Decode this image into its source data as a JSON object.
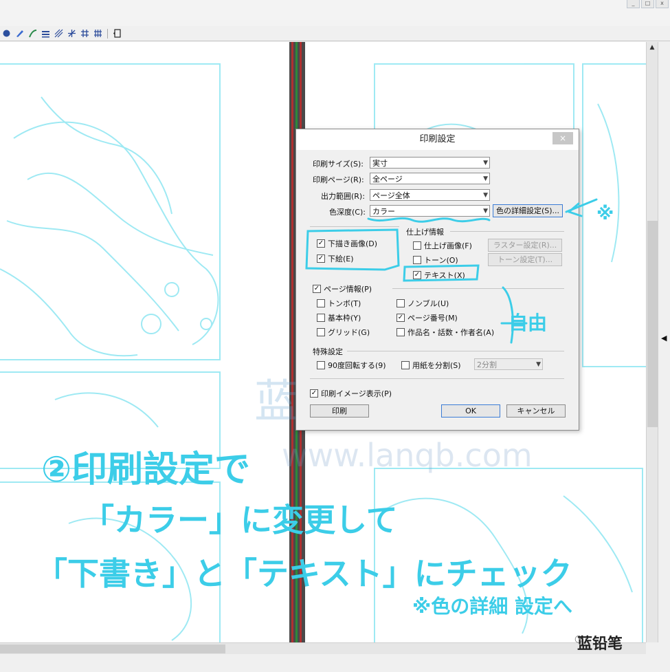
{
  "window": {
    "minimize": "_",
    "maximize": "□",
    "close": "x"
  },
  "toolbar": {
    "icons": [
      "paint-icon",
      "brush-icon",
      "pen-icon",
      "layer-icon",
      "hatch-icon",
      "ruler-icon",
      "grid-icon",
      "grid-alt-icon",
      "panel-icon"
    ]
  },
  "dialog": {
    "title": "印刷設定",
    "close": "×",
    "print_size": {
      "label": "印刷サイズ(S):",
      "value": "実寸"
    },
    "print_page": {
      "label": "印刷ページ(R):",
      "value": "全ページ"
    },
    "output_range": {
      "label": "出力範囲(R):",
      "value": "ページ全体"
    },
    "color_depth": {
      "label": "色深度(C):",
      "value": "カラー"
    },
    "color_detail_button": "色の詳細設定(S)...",
    "draft_group": {
      "rough_sketch": {
        "label": "下描き画像(D)",
        "checked": true
      },
      "draft": {
        "label": "下絵(E)",
        "checked": true
      }
    },
    "finish_group": {
      "title": "仕上げ情報",
      "finish_image": {
        "label": "仕上げ画像(F)",
        "checked": false
      },
      "tone": {
        "label": "トーン(O)",
        "checked": false
      },
      "text": {
        "label": "テキスト(X)",
        "checked": true
      },
      "raster_button": "ラスター設定(R)...",
      "tone_button": "トーン設定(T)..."
    },
    "page_info": {
      "label": "ページ情報(P)",
      "checked": true,
      "tombo": {
        "label": "トンボ(T)",
        "checked": false
      },
      "nombre": {
        "label": "ノンブル(U)",
        "checked": false
      },
      "base_frame": {
        "label": "基本枠(Y)",
        "checked": false
      },
      "page_number": {
        "label": "ページ番号(M)",
        "checked": true
      },
      "grid": {
        "label": "グリッド(G)",
        "checked": false
      },
      "work_name": {
        "label": "作品名・話数・作者名(A)",
        "checked": false
      }
    },
    "special": {
      "title": "特殊設定",
      "rotate": {
        "label": "90度回転する(9)",
        "checked": false
      },
      "split": {
        "label": "用紙を分割(S)",
        "checked": false
      },
      "split_value": "2分割"
    },
    "print_preview": {
      "label": "印刷イメージ表示(P)",
      "checked": true
    },
    "buttons": {
      "print": "印刷",
      "ok": "OK",
      "cancel": "キャンセル"
    }
  },
  "annotations": {
    "line1": "②印刷設定で",
    "line2": "「カラー」に変更して",
    "line3": "「下書き」と「テキスト」にチェック",
    "note": "※色の詳細 設定へ",
    "free": "自由",
    "asterisk": "※"
  },
  "watermark": {
    "cn": "蓝铅笔·快乐学",
    "url": "www.lanqb.com"
  },
  "logo": "蓝铅笔",
  "colors": {
    "annotation": "#3ccde8",
    "sketch": "#7fe3ef",
    "gutter_red": "#b03030",
    "gutter_green": "#2e8a3a"
  }
}
